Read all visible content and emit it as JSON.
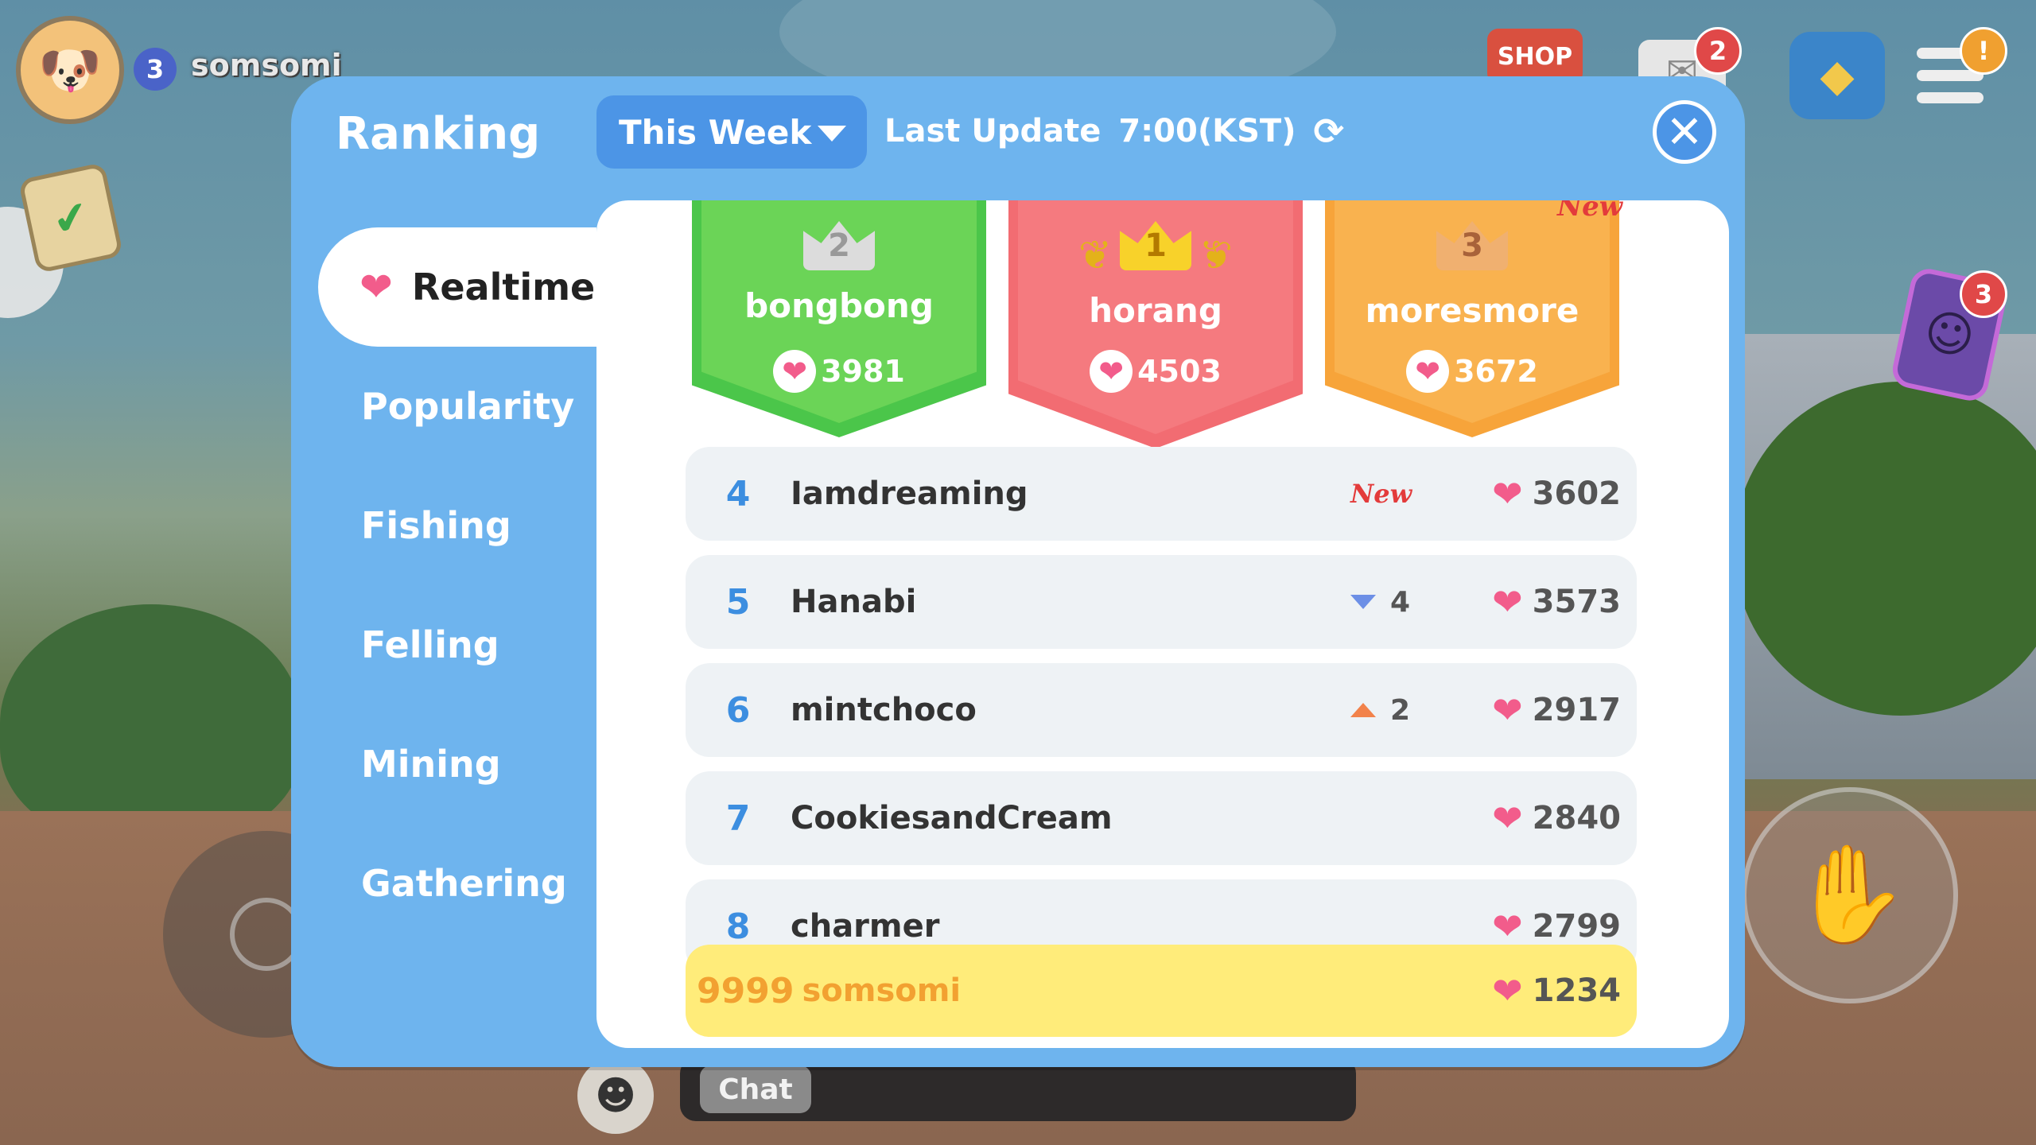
{
  "hud": {
    "player_level": "3",
    "player_name": "somsomi",
    "shop_label": "SHOP",
    "mail_badge": "2",
    "menu_badge": "!",
    "phone_badge": "3",
    "chat_label": "Chat"
  },
  "ranking": {
    "title": "Ranking",
    "period": "This Week",
    "last_update_label": "Last Update",
    "last_update_time": "7:00(KST)",
    "categories": [
      {
        "label": "Realtime",
        "active": true
      },
      {
        "label": "Popularity",
        "active": false
      },
      {
        "label": "Fishing",
        "active": false
      },
      {
        "label": "Felling",
        "active": false
      },
      {
        "label": "Mining",
        "active": false
      },
      {
        "label": "Gathering",
        "active": false
      }
    ],
    "podium": [
      {
        "rank": "2",
        "name": "bongbong",
        "score": "3981",
        "color": "#6bd457"
      },
      {
        "rank": "1",
        "name": "horang",
        "score": "4503",
        "color": "#f57a7f"
      },
      {
        "rank": "3",
        "name": "moresmore",
        "score": "3672",
        "color": "#f9b24f",
        "tag": "New"
      }
    ],
    "rows": [
      {
        "rank": "4",
        "name": "Iamdreaming",
        "tag": "New",
        "score": "3602"
      },
      {
        "rank": "5",
        "name": "Hanabi",
        "change": "4",
        "direction": "down",
        "score": "3573"
      },
      {
        "rank": "6",
        "name": "mintchoco",
        "change": "2",
        "direction": "up",
        "score": "2917"
      },
      {
        "rank": "7",
        "name": "CookiesandCream",
        "score": "2840"
      },
      {
        "rank": "8",
        "name": "charmer",
        "score": "2799"
      }
    ],
    "self": {
      "rank": "9999",
      "name": "somsomi",
      "score": "1234"
    }
  },
  "colors": {
    "panel": "#6eb4ee",
    "accent_blue": "#4c95e6",
    "heart": "#f25c8b",
    "self_row": "#ffec7a"
  },
  "icons": [
    "heart-icon",
    "refresh-icon",
    "close-icon",
    "crown-icon",
    "chevron-down-icon",
    "rank-up-icon",
    "rank-down-icon"
  ]
}
